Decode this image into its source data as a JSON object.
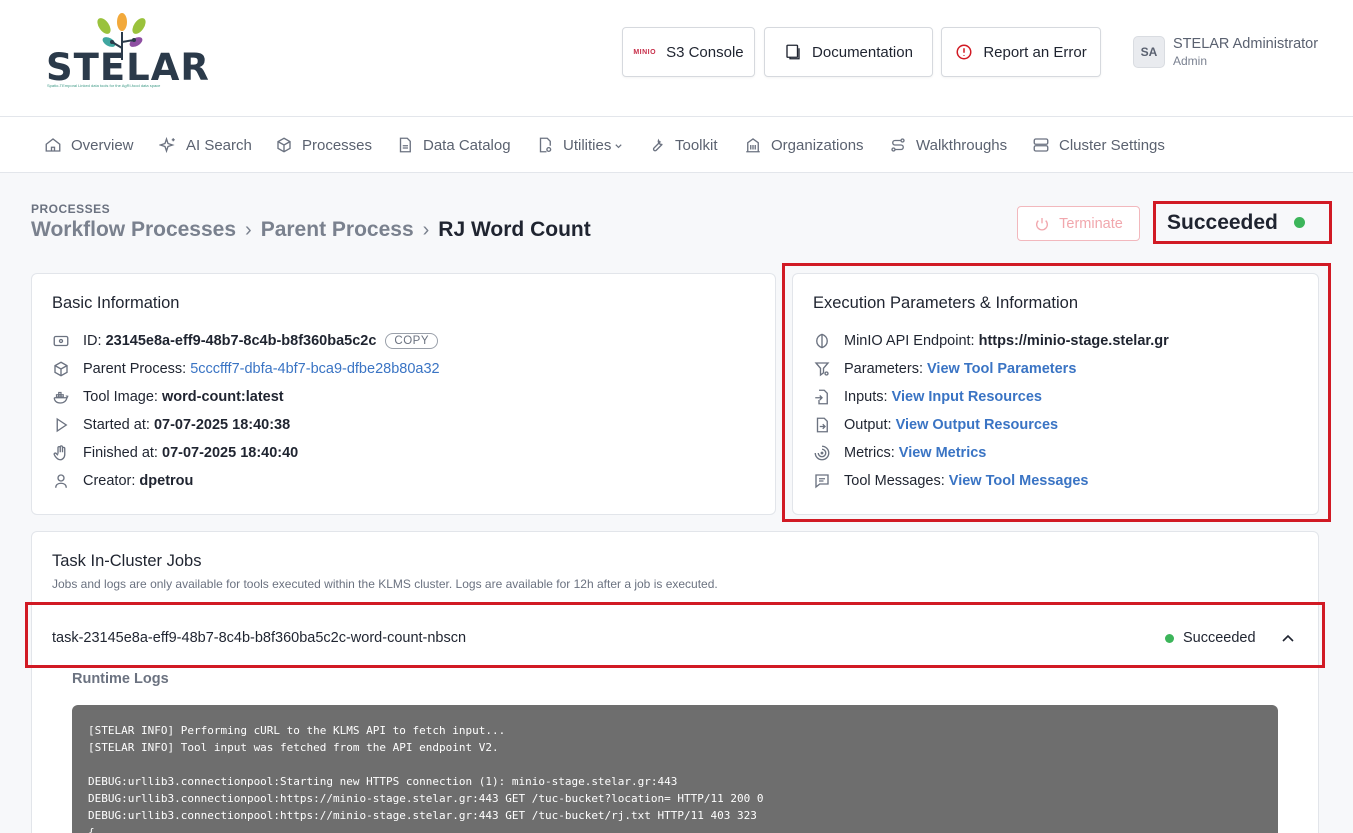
{
  "header": {
    "logo_text": "STELAR",
    "logo_tagline": "Spatio-TEmporal Linked data tools for the AgRI-food data space",
    "buttons": {
      "s3_console": "S3 Console",
      "s3_console_mark": "MINIO",
      "documentation": "Documentation",
      "report_error": "Report an Error"
    },
    "user": {
      "initials": "SA",
      "name": "STELAR Administrator",
      "role": "Admin"
    }
  },
  "nav": {
    "items": [
      {
        "label": "Overview",
        "icon": "home-icon"
      },
      {
        "label": "AI Search",
        "icon": "sparkle-icon"
      },
      {
        "label": "Processes",
        "icon": "cube-icon"
      },
      {
        "label": "Data Catalog",
        "icon": "file-icon"
      },
      {
        "label": "Utilities",
        "icon": "settings-file-icon"
      },
      {
        "label": "Toolkit",
        "icon": "wrench-icon"
      },
      {
        "label": "Organizations",
        "icon": "building-icon"
      },
      {
        "label": "Walkthroughs",
        "icon": "route-icon"
      },
      {
        "label": "Cluster Settings",
        "icon": "server-icon"
      }
    ]
  },
  "page": {
    "section_label": "PROCESSES",
    "breadcrumbs": [
      "Workflow Processes",
      "Parent Process",
      "RJ Word Count"
    ],
    "terminate_label": "Terminate",
    "status": "Succeeded",
    "status_color": "#3cb55a"
  },
  "basic_info": {
    "title": "Basic Information",
    "id_label": "ID:",
    "id_value": "23145e8a-eff9-48b7-8c4b-b8f360ba5c2c",
    "copy_label": "COPY",
    "parent_label": "Parent Process:",
    "parent_value": "5cccfff7-dbfa-4bf7-bca9-dfbe28b80a32",
    "image_label": "Tool Image:",
    "image_value": "word-count:latest",
    "started_label": "Started at:",
    "started_value": "07-07-2025 18:40:38",
    "finished_label": "Finished at:",
    "finished_value": "07-07-2025 18:40:40",
    "creator_label": "Creator:",
    "creator_value": "dpetrou"
  },
  "exec_info": {
    "title": "Execution Parameters & Information",
    "endpoint_label": "MinIO API Endpoint:",
    "endpoint_value": "https://minio-stage.stelar.gr",
    "params_label": "Parameters:",
    "params_link": "View Tool Parameters",
    "inputs_label": "Inputs:",
    "inputs_link": "View Input Resources",
    "output_label": "Output:",
    "output_link": "View Output Resources",
    "metrics_label": "Metrics:",
    "metrics_link": "View Metrics",
    "messages_label": "Tool Messages:",
    "messages_link": "View Tool Messages"
  },
  "jobs": {
    "title": "Task In-Cluster Jobs",
    "subtitle": "Jobs and logs are only available for tools executed within the KLMS cluster. Logs are available for 12h after a job is executed.",
    "job_name": "task-23145e8a-eff9-48b7-8c4b-b8f360ba5c2c-word-count-nbscn",
    "job_status": "Succeeded",
    "runtime_logs_label": "Runtime Logs",
    "logs": "[STELAR INFO] Performing cURL to the KLMS API to fetch input...\n[STELAR INFO] Tool input was fetched from the API endpoint V2.\n\nDEBUG:urllib3.connectionpool:Starting new HTTPS connection (1): minio-stage.stelar.gr:443\nDEBUG:urllib3.connectionpool:https://minio-stage.stelar.gr:443 GET /tuc-bucket?location= HTTP/11 200 0\nDEBUG:urllib3.connectionpool:https://minio-stage.stelar.gr:443 GET /tuc-bucket/rj.txt HTTP/11 403 323\n{"
  }
}
